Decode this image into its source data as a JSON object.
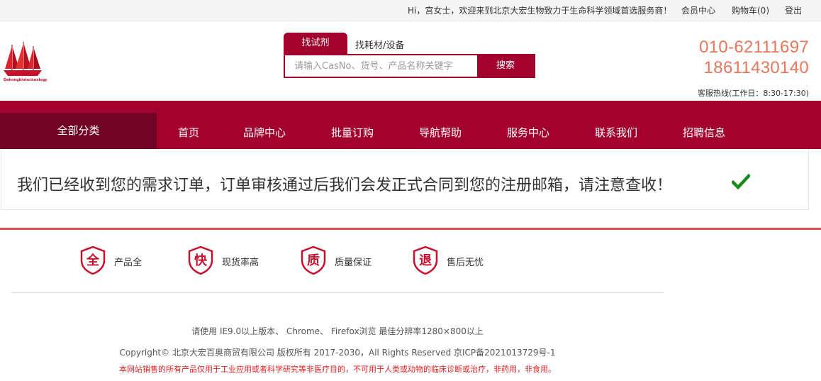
{
  "topbar": {
    "greeting": "Hi，宫女士，欢迎来到北京大宏生物致力于生命科学领域首选服务商！",
    "member_center": "会员中心",
    "cart": "购物车(0)",
    "logout": "登出"
  },
  "logo": {
    "icon": "sailing-ship-logo",
    "text": "Dahongbiotechnology"
  },
  "search": {
    "tab_active": "找试剂",
    "tab_other": "找耗材/设备",
    "placeholder": "请输入CasNo、货号、产品名称关键字",
    "button": "搜索"
  },
  "contact": {
    "phone1": "010-62111697",
    "phone2": "18611430140",
    "hotline": "客服热线(工作日：8:30-17:30)"
  },
  "nav": {
    "all_categories": "全部分类",
    "items": [
      "首页",
      "品牌中心",
      "批量订购",
      "导航帮助",
      "服务中心",
      "联系我们",
      "招聘信息"
    ]
  },
  "message": {
    "text": "我们已经收到您的需求订单，订单审核通过后我们会发正式合同到您的注册邮箱，请注意查收！",
    "icon": "check-icon"
  },
  "features": [
    {
      "badge": "全",
      "label": "产品全"
    },
    {
      "badge": "快",
      "label": "现货率高"
    },
    {
      "badge": "质",
      "label": "质量保证"
    },
    {
      "badge": "退",
      "label": "售后无忧"
    }
  ],
  "footer": {
    "browser_note": "请使用   IE9.0以上版本、    Chrome、    Firefox浏览 最佳分辨率1280×800以上",
    "copyright": "Copyright© 北京大宏百奥商贸有限公司 版权所有 2017-2030，All Rights Reserved     京ICP备2021013729号-1",
    "disclaimer": "本网站销售的所有产品仅用于工业应用或者科学研究等非医疗目的，不可用于人类或动物的临床诊断或治疗，非药用，非食用。"
  },
  "colors": {
    "brand": "#a2002d",
    "nav_dark": "#6e0323",
    "phone": "#e8765a",
    "check": "#1a8a1a",
    "disclaimer": "#e02020"
  }
}
